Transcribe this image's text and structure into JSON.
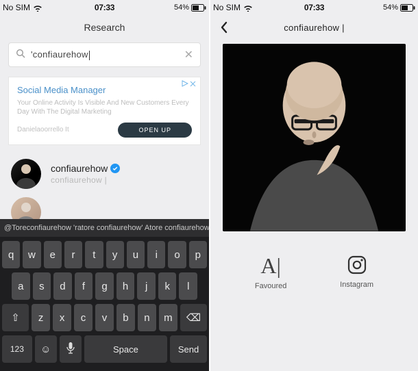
{
  "left": {
    "status": {
      "carrier": "No SIM",
      "time": "07:33",
      "battery_pct": "54%"
    },
    "header": {
      "title": "Research"
    },
    "search": {
      "value": "confiaurehow",
      "placeholder": ""
    },
    "ad": {
      "title": "Social Media Manager",
      "body": "Your Online Activity Is Visible And New Customers Every Day With The Digital Marketing",
      "domain": "Danielaoorrello It",
      "cta": "OPEN UP"
    },
    "results": [
      {
        "name": "confiaurehow",
        "subtitle": "confiaurehow |",
        "verified": true
      }
    ],
    "suggestion_strip": "@Toreconfiaurehow 'ratore confiaurehow' Atore confiaurehow|",
    "keyboard": {
      "row1": [
        "q",
        "w",
        "e",
        "r",
        "t",
        "y",
        "u",
        "i",
        "o",
        "p"
      ],
      "row2": [
        "a",
        "s",
        "d",
        "f",
        "g",
        "h",
        "j",
        "k",
        "l"
      ],
      "row3_shift": "⇧",
      "row3": [
        "z",
        "x",
        "c",
        "v",
        "b",
        "n",
        "m"
      ],
      "row3_del": "⌫",
      "row4": {
        "numbers": "123",
        "emoji": "☺",
        "mic": "🎤",
        "space": "Space",
        "send": "Send"
      }
    }
  },
  "right": {
    "status": {
      "carrier": "No SIM",
      "time": "07:33",
      "battery_pct": "54%"
    },
    "header": {
      "title": "confiaurehow |"
    },
    "actions": {
      "favoured": {
        "glyph": "A|",
        "label": "Favoured"
      },
      "instagram": {
        "label": "Instagram"
      }
    }
  }
}
